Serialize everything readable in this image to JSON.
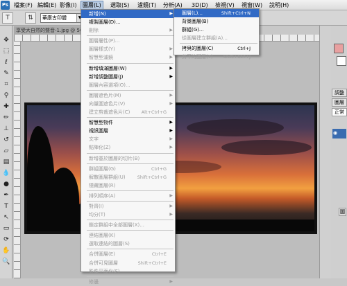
{
  "menubar": {
    "logo": "Ps",
    "items": [
      "檔案(F)",
      "編輯(E)",
      "影像(I)",
      "圖層(L)",
      "選取(S)",
      "濾鏡(T)",
      "分析(A)",
      "3D(D)",
      "檢視(V)",
      "視窗(W)",
      "說明(H)"
    ]
  },
  "options": {
    "font": "華康古印體"
  },
  "document": {
    "tab_title": "享受大自然的聲音-1.jpg @ 50%"
  },
  "panels": {
    "layers_tab": "圖層",
    "blend_mode": "正常",
    "adjust_tab": "調整"
  },
  "layer_menu": [
    {
      "label": "新增(N)",
      "submenu": true,
      "highlighted": true
    },
    {
      "label": "複製圖層(D)..."
    },
    {
      "label": "刪除",
      "submenu": true,
      "disabled": true
    },
    {
      "sep": true
    },
    {
      "label": "圖層屬性(P)...",
      "disabled": true
    },
    {
      "label": "圖層樣式(Y)",
      "submenu": true,
      "disabled": true
    },
    {
      "label": "智慧型濾鏡",
      "submenu": true,
      "disabled": true
    },
    {
      "sep": true
    },
    {
      "label": "新增填滿圖層(W)",
      "submenu": true
    },
    {
      "label": "新增調整圖層(J)",
      "submenu": true
    },
    {
      "label": "圖層內容選項(O)...",
      "disabled": true
    },
    {
      "sep": true
    },
    {
      "label": "圖層遮色片(M)",
      "submenu": true,
      "disabled": true
    },
    {
      "label": "向量圖遮色片(V)",
      "submenu": true,
      "disabled": true
    },
    {
      "label": "建立剪裁遮色片(C)",
      "shortcut": "Alt+Ctrl+G",
      "disabled": true
    },
    {
      "sep": true
    },
    {
      "label": "智慧型物件",
      "submenu": true
    },
    {
      "label": "視訊圖層",
      "submenu": true
    },
    {
      "label": "文字",
      "submenu": true,
      "disabled": true
    },
    {
      "label": "點陣化(Z)",
      "submenu": true,
      "disabled": true
    },
    {
      "sep": true
    },
    {
      "label": "新增基於圖層的切片(B)",
      "disabled": true
    },
    {
      "sep": true
    },
    {
      "label": "群組圖層(G)",
      "shortcut": "Ctrl+G",
      "disabled": true
    },
    {
      "label": "解散圖層群組(U)",
      "shortcut": "Shift+Ctrl+G",
      "disabled": true
    },
    {
      "label": "隱藏圖層(R)",
      "disabled": true
    },
    {
      "sep": true
    },
    {
      "label": "排列順序(A)",
      "submenu": true,
      "disabled": true
    },
    {
      "sep": true
    },
    {
      "label": "對齊(I)",
      "submenu": true,
      "disabled": true
    },
    {
      "label": "均分(T)",
      "submenu": true,
      "disabled": true
    },
    {
      "sep": true
    },
    {
      "label": "鎖定群組中全部圖層(X)...",
      "disabled": true
    },
    {
      "sep": true
    },
    {
      "label": "連結圖層(K)",
      "disabled": true
    },
    {
      "label": "選取連結的圖層(S)",
      "disabled": true
    },
    {
      "sep": true
    },
    {
      "label": "合併圖層(E)",
      "shortcut": "Ctrl+E",
      "disabled": true
    },
    {
      "label": "合併可見圖層",
      "shortcut": "Shift+Ctrl+E",
      "disabled": true
    },
    {
      "label": "影像平面化(F)",
      "disabled": true
    },
    {
      "sep": true
    },
    {
      "label": "修邊",
      "submenu": true,
      "disabled": true
    }
  ],
  "new_submenu": [
    {
      "label": "圖層(L)...",
      "shortcut": "Shift+Ctrl+N",
      "highlighted": true
    },
    {
      "label": "背景圖層(B)"
    },
    {
      "label": "群組(G)..."
    },
    {
      "label": "從圖層建立群組(A)...",
      "disabled": true
    },
    {
      "sep": true
    },
    {
      "label": "拷貝的圖層(C)",
      "shortcut": "Ctrl+J"
    },
    {
      "label": "剪下的圖層(T)",
      "shortcut": "Shift+Ctrl+J",
      "disabled": true
    }
  ],
  "colors": {
    "menu_highlight": "#316ac5",
    "disabled_text": "#9a9a9a",
    "active_menu_bg": "#b8cbe2"
  }
}
